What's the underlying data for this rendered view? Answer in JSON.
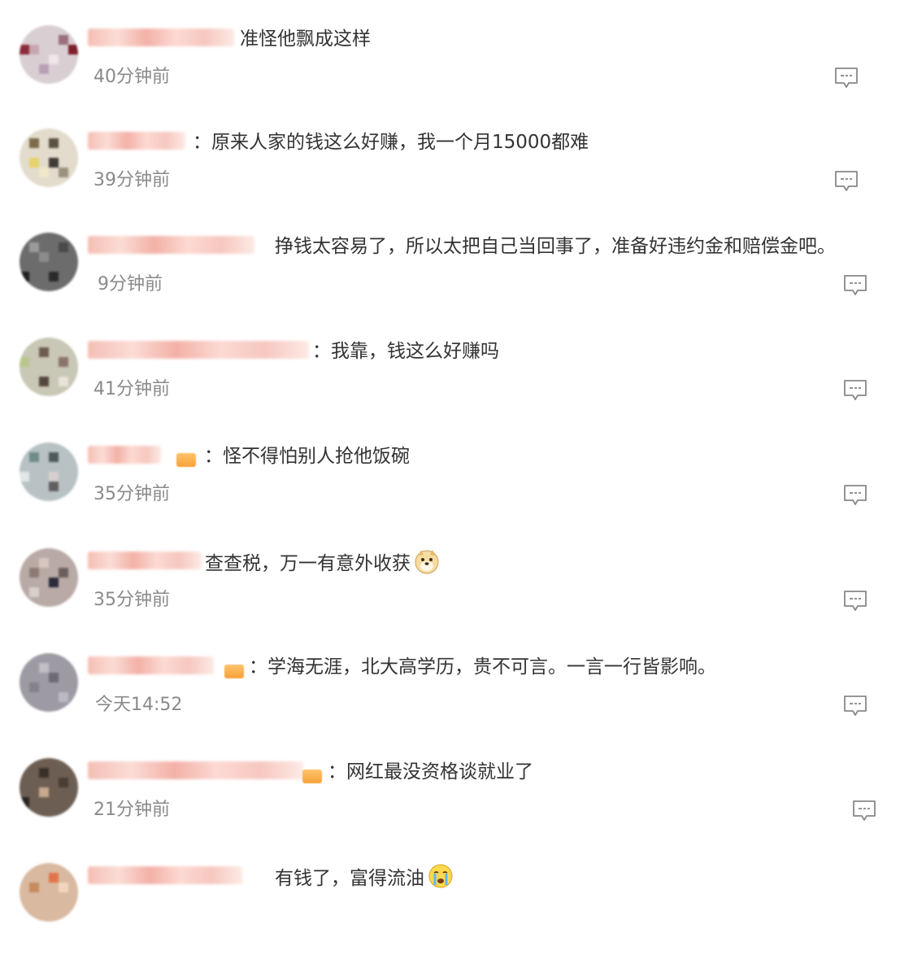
{
  "comments": [
    {
      "text": "准怪他飘成这样",
      "time": "40分钟前"
    },
    {
      "text": "：原来人家的钱这么好赚，我一个月15000都难",
      "time": "39分钟前"
    },
    {
      "text": "挣钱太容易了，所以太把自己当回事了，准备好违约金和赔偿金吧。",
      "time": "9分钟前"
    },
    {
      "text": "：我靠，钱这么好赚吗",
      "time": "41分钟前"
    },
    {
      "text": "：怪不得怕别人抢他饭碗",
      "time": "35分钟前"
    },
    {
      "text": "查查税，万一有意外收获",
      "time": "35分钟前",
      "emoji": "doge-emoji"
    },
    {
      "text": "：学海无涯，北大高学历，贵不可言。一言一行皆影响。",
      "time": "今天14:52"
    },
    {
      "text": "：网红最没资格谈就业了",
      "time": "21分钟前"
    },
    {
      "text": "有钱了，富得流油",
      "time": "",
      "emoji": "crying-emoji"
    }
  ],
  "icons": {
    "reply": "comment-reply-icon"
  },
  "colors": {
    "text": "#333333",
    "time": "#8a8a8a",
    "icon": "#888888",
    "name_blur": "#f4b8ad",
    "badge": "#f7a23a"
  }
}
